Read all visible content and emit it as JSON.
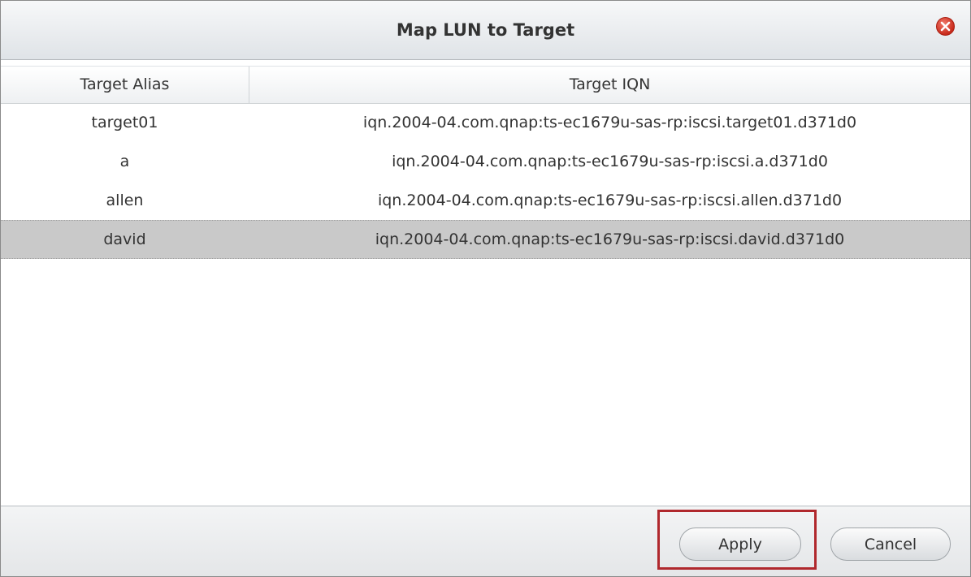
{
  "dialog": {
    "title": "Map LUN to Target",
    "close_icon": "close-icon"
  },
  "colors": {
    "close_button": "#d93b2b",
    "selected_row": "#c9c9c9",
    "highlight_box": "#b0282d"
  },
  "table": {
    "headers": {
      "alias": "Target Alias",
      "iqn": "Target IQN"
    },
    "rows": [
      {
        "alias": "target01",
        "iqn": "iqn.2004-04.com.qnap:ts-ec1679u-sas-rp:iscsi.target01.d371d0",
        "selected": false
      },
      {
        "alias": "a",
        "iqn": "iqn.2004-04.com.qnap:ts-ec1679u-sas-rp:iscsi.a.d371d0",
        "selected": false
      },
      {
        "alias": "allen",
        "iqn": "iqn.2004-04.com.qnap:ts-ec1679u-sas-rp:iscsi.allen.d371d0",
        "selected": false
      },
      {
        "alias": "david",
        "iqn": "iqn.2004-04.com.qnap:ts-ec1679u-sas-rp:iscsi.david.d371d0",
        "selected": true
      }
    ]
  },
  "footer": {
    "apply_label": "Apply",
    "cancel_label": "Cancel"
  }
}
